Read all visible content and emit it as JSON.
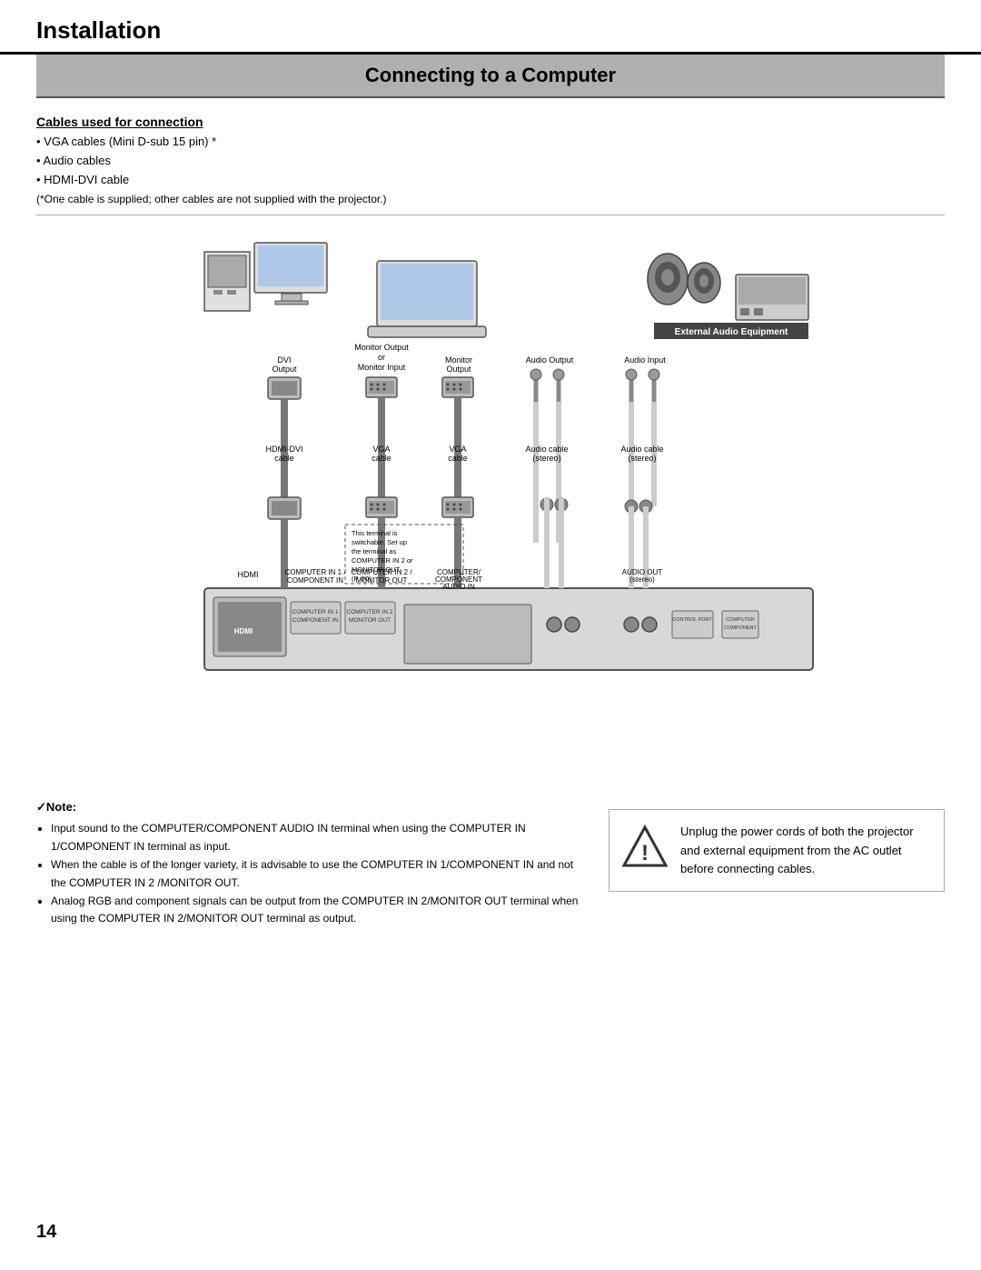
{
  "header": {
    "title": "Installation"
  },
  "section": {
    "title": "Connecting to a Computer"
  },
  "cables": {
    "heading": "Cables used for connection",
    "items": [
      "• VGA cables (Mini D-sub 15 pin) *",
      "• Audio cables",
      "• HDMI-DVI cable"
    ],
    "footnote": "(*One cable is supplied; other cables are not supplied with the projector.)"
  },
  "notes": {
    "heading": "✓Note:",
    "items": [
      "Input sound to the COMPUTER/COMPONENT AUDIO IN terminal when using the COMPUTER IN 1/COMPONENT IN terminal as input.",
      "When the cable is of the longer variety, it is advisable to use the COMPUTER IN 1/COMPONENT IN and not the COMPUTER IN 2 /MONITOR OUT.",
      "Analog RGB and component signals can be output from the COMPUTER IN 2/MONITOR OUT terminal when using the COMPUTER IN 2/MONITOR OUT terminal as output."
    ]
  },
  "warning": {
    "text": "Unplug the power cords of both the projector and external equipment from the AC outlet before connecting cables."
  },
  "page_number": "14",
  "diagram": {
    "labels": {
      "dvi_output": "DVI\nOutput",
      "monitor_output": "Monitor Output\nor\nMonitor Input",
      "monitor_output2": "Monitor\nOutput",
      "audio_output": "Audio Output",
      "audio_input": "Audio Input",
      "external_audio": "External Audio Equipment",
      "hdmi_dvi_cable": "HDMI-DVI\ncable",
      "vga_cable1": "VGA\ncable",
      "vga_cable2": "VGA\ncable",
      "audio_cable_stereo1": "Audio cable\n(stereo)",
      "audio_cable_stereo2": "Audio cable\n(stereo)",
      "hdmi_label": "HDMI",
      "comp_in1": "COMPUTER IN 1 /\nCOMPONENT IN",
      "comp_in2": "COMPUTER IN 2 /\nMONITOR OUT",
      "computer_component": "COMPUTER/\nCOMPONENT\nAUDIO IN",
      "audio_out": "AUDIO OUT\n(stereo)",
      "switchable_note": "This terminal is\nswitchable. Set up\nthe terminal as\nCOMPUTER IN 2 or\nMONITOR OUT.\n(P. 50)"
    }
  }
}
